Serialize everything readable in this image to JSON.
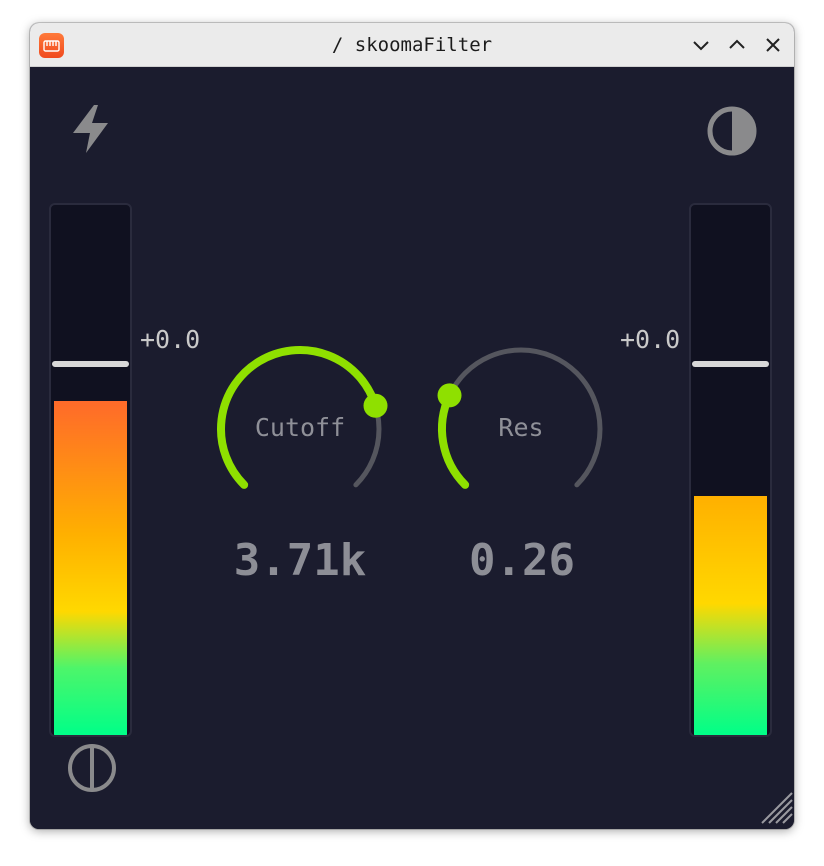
{
  "window": {
    "title": "/ skoomaFilter",
    "app_icon": "app-logo-icon",
    "controls": [
      "minimize-icon",
      "maximize-icon",
      "close-icon"
    ]
  },
  "colors": {
    "background": "#1b1c2e",
    "knob_active": "#8fe000",
    "knob_track": "#55565e",
    "text_muted": "#8d8e96",
    "meter_hot": "#ff6a2a",
    "meter_mid": "#ffd000",
    "meter_low": "#00ff88"
  },
  "toolbar": {
    "top_left_icon": "lightning-bolt-icon",
    "top_right_icon": "contrast-icon",
    "bottom_left_icon": "phase-invert-icon"
  },
  "input_meter": {
    "gain_label": "+0.0",
    "level_fraction": 0.63
  },
  "output_meter": {
    "gain_label": "+0.0",
    "level_fraction": 0.45
  },
  "cutoff_knob": {
    "label": "Cutoff",
    "value": "3.71k",
    "position_fraction": 0.77
  },
  "res_knob": {
    "label": "Res",
    "value": "0.26",
    "position_fraction": 0.26
  }
}
